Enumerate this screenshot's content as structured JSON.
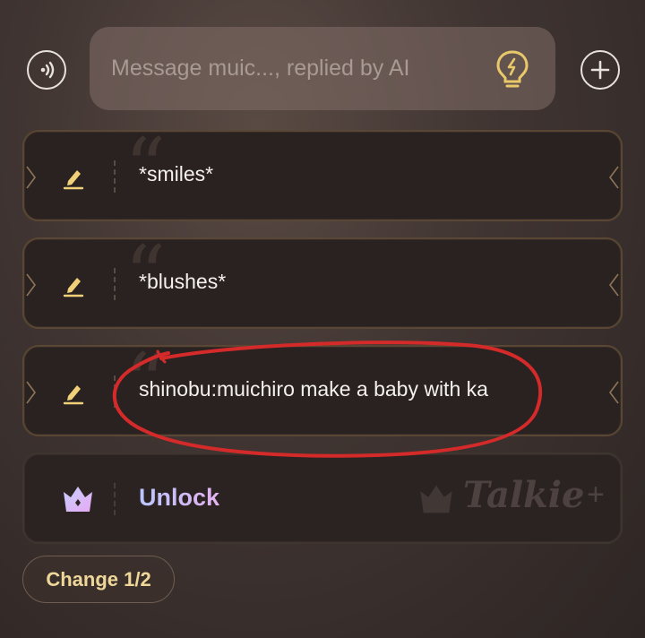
{
  "composer": {
    "placeholder": "Message muic..., replied by AI",
    "left_icon": "voice-wave-icon",
    "hint_icon": "lightbulb-icon",
    "right_icon": "plus-icon"
  },
  "suggestions": [
    {
      "text": "*smiles*",
      "icon": "pencil-edit-icon"
    },
    {
      "text": "*blushes*",
      "icon": "pencil-edit-icon"
    },
    {
      "text": "shinobu:muichiro make a baby with ka",
      "icon": "pencil-edit-icon"
    }
  ],
  "unlock": {
    "label": "Unlock",
    "icon": "crown-icon",
    "watermark": "Talkie",
    "watermark_suffix": "+"
  },
  "change_button": {
    "label": "Change 1/2"
  },
  "colors": {
    "accent_gold": "#efd79a",
    "annotation_red": "#d42a2a",
    "unlock_gradient_start": "#b9c6ff",
    "unlock_gradient_end": "#e4b2f0"
  }
}
